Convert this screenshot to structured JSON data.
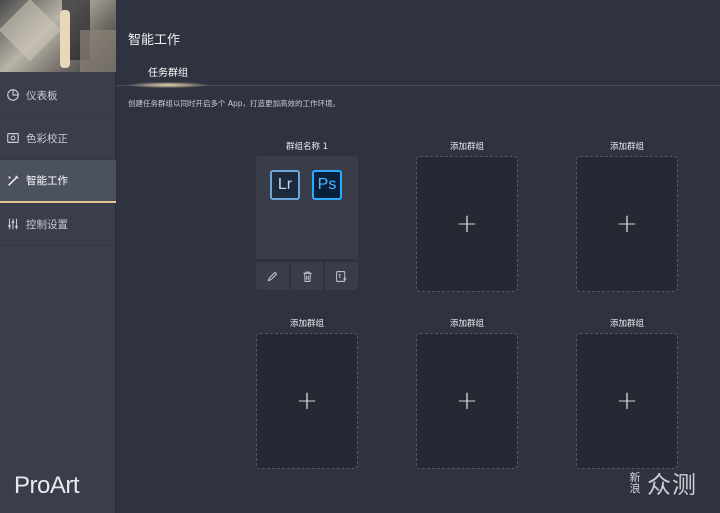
{
  "sidebar": {
    "items": [
      {
        "label": "仪表板",
        "icon": "dashboard-icon"
      },
      {
        "label": "色彩校正",
        "icon": "color-calibration-icon"
      },
      {
        "label": "智能工作",
        "icon": "smart-work-icon",
        "active": true
      },
      {
        "label": "控制设置",
        "icon": "control-settings-icon"
      }
    ],
    "brand": "ProArt"
  },
  "header": {
    "title": "智能工作",
    "tab": "任务群组",
    "description": "创建任务群组以同时开启多个 App，打造更加高效的工作环境。"
  },
  "groups": [
    {
      "label": "群组名称 1",
      "apps": [
        "Lr",
        "Ps"
      ]
    },
    {
      "label": "添加群组"
    },
    {
      "label": "添加群组"
    },
    {
      "label": "添加群组"
    },
    {
      "label": "添加群组"
    },
    {
      "label": "添加群组"
    }
  ],
  "add_symbol": "+",
  "watermark": {
    "small_top": "新",
    "small_bottom": "浪",
    "big": "众测"
  },
  "colors": {
    "accent": "#e7c48e",
    "background": "#2f3340",
    "sidebar": "#3a3e4b",
    "lr_blue": "#6fa6d9",
    "ps_blue": "#2fa8ff"
  }
}
